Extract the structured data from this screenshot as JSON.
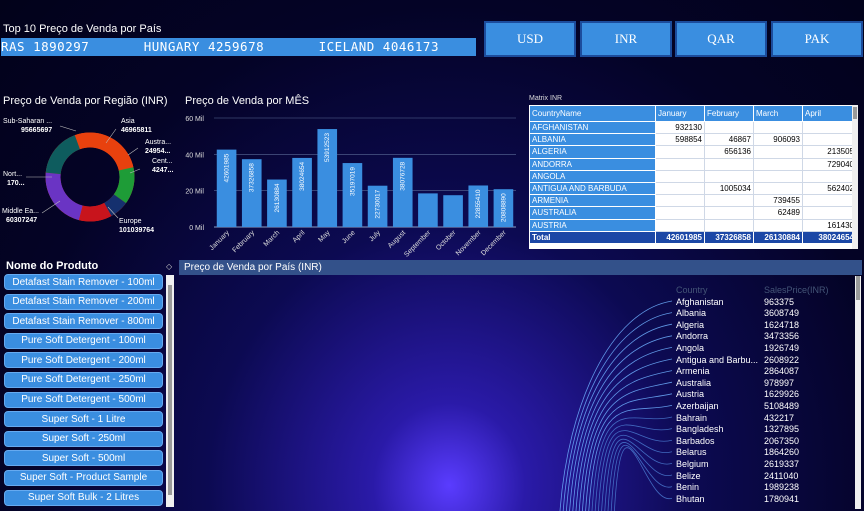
{
  "ticker": {
    "title": "Top 10  Preço de Venda por País",
    "items": [
      "RAS 1890297",
      "HUNGARY 4259678",
      "ICELAND 4046173"
    ]
  },
  "currency_buttons": [
    "USD",
    "INR",
    "QAR",
    "PAK"
  ],
  "donut": {
    "title": "Preço de Venda por Região (INR)",
    "labels": [
      {
        "name": "Sub-Saharan ...",
        "value": "95665697"
      },
      {
        "name": "Asia",
        "value": "46965811"
      },
      {
        "name": "Austra...",
        "value": "24954..."
      },
      {
        "name": "Cent...",
        "value": "4247..."
      },
      {
        "name": "Europe",
        "value": "101039764"
      },
      {
        "name": "Middle Ea...",
        "value": "60307247"
      },
      {
        "name": "Nort...",
        "value": "170..."
      }
    ]
  },
  "bar_chart": {
    "title": "Preço de Venda por MÊS"
  },
  "chart_data": {
    "type": "bar",
    "categories": [
      "January",
      "February",
      "March",
      "April",
      "May",
      "June",
      "July",
      "August",
      "September",
      "October",
      "November",
      "December"
    ],
    "values": [
      42601985,
      37326858,
      26130884,
      38024654,
      53912523,
      35197019,
      22730017,
      38076728,
      18500000,
      17500000,
      22855410,
      20808890
    ],
    "data_labels": [
      "42601985",
      "37326858",
      "26130884",
      "38024654",
      "53912523",
      "35197019",
      "22730017",
      "38076728",
      "",
      "",
      "22855410",
      "20808890"
    ],
    "yticks": [
      "0 Mil",
      "20 Mil",
      "40 Mil",
      "60 Mil"
    ],
    "ylim": [
      0,
      60000000
    ],
    "title": "Preço de Venda por MÊS"
  },
  "matrix": {
    "title": "Matrix INR",
    "columns": [
      "CountryName",
      "January",
      "February",
      "March",
      "April"
    ],
    "rows": [
      [
        "AFGHANISTAN",
        "932130",
        "",
        "",
        ""
      ],
      [
        "ALBANIA",
        "598854",
        "46867",
        "906093",
        ""
      ],
      [
        "ALGERIA",
        "",
        "656136",
        "",
        "213505"
      ],
      [
        "ANDORRA",
        "",
        "",
        "",
        "729040"
      ],
      [
        "ANGOLA",
        "",
        "",
        "",
        ""
      ],
      [
        "ANTIGUA AND BARBUDA",
        "",
        "1005034",
        "",
        "562402"
      ],
      [
        "ARMENIA",
        "",
        "",
        "739455",
        ""
      ],
      [
        "AUSTRALIA",
        "",
        "",
        "62489",
        ""
      ],
      [
        "AUSTRIA",
        "",
        "",
        "",
        "161430"
      ]
    ],
    "total": [
      "Total",
      "42601985",
      "37326858",
      "26130884",
      "38024654"
    ]
  },
  "slicer": {
    "title": "Nome do Produto",
    "items": [
      "Detafast Stain Remover - 100ml",
      "Detafast Stain Remover - 200ml",
      "Detafast Stain Remover - 800ml",
      "Pure Soft Detergent - 100ml",
      "Pure Soft Detergent - 200ml",
      "Pure Soft Detergent - 250ml",
      "Pure Soft Detergent - 500ml",
      "Super Soft - 1 Litre",
      "Super Soft - 250ml",
      "Super Soft - 500ml",
      "Super Soft - Product Sample",
      "Super Soft Bulk - 2 Litres"
    ]
  },
  "country_panel": {
    "title": "Preço de Venda por País (INR)",
    "col_headers": [
      "Country",
      "SalesPrice(INR)"
    ],
    "rows": [
      [
        "Afghanistan",
        "963375"
      ],
      [
        "Albania",
        "3608749"
      ],
      [
        "Algeria",
        "1624718"
      ],
      [
        "Andorra",
        "3473356"
      ],
      [
        "Angola",
        "1926749"
      ],
      [
        "Antigua and Barbu...",
        "2608922"
      ],
      [
        "Armenia",
        "2864087"
      ],
      [
        "Australia",
        "978997"
      ],
      [
        "Austria",
        "1629926"
      ],
      [
        "Azerbaijan",
        "5108489"
      ],
      [
        "Bahrain",
        "432217"
      ],
      [
        "Bangladesh",
        "1327895"
      ],
      [
        "Barbados",
        "2067350"
      ],
      [
        "Belarus",
        "1864260"
      ],
      [
        "Belgium",
        "2619337"
      ],
      [
        "Belize",
        "2411040"
      ],
      [
        "Benin",
        "1989238"
      ],
      [
        "Bhutan",
        "1780941"
      ]
    ]
  },
  "colors": {
    "accent": "#3a8ee0",
    "donut": [
      "#e8410e",
      "#1e9c37",
      "#15306e",
      "#c8141c",
      "#6a34c4",
      "#0e5c5e"
    ]
  }
}
